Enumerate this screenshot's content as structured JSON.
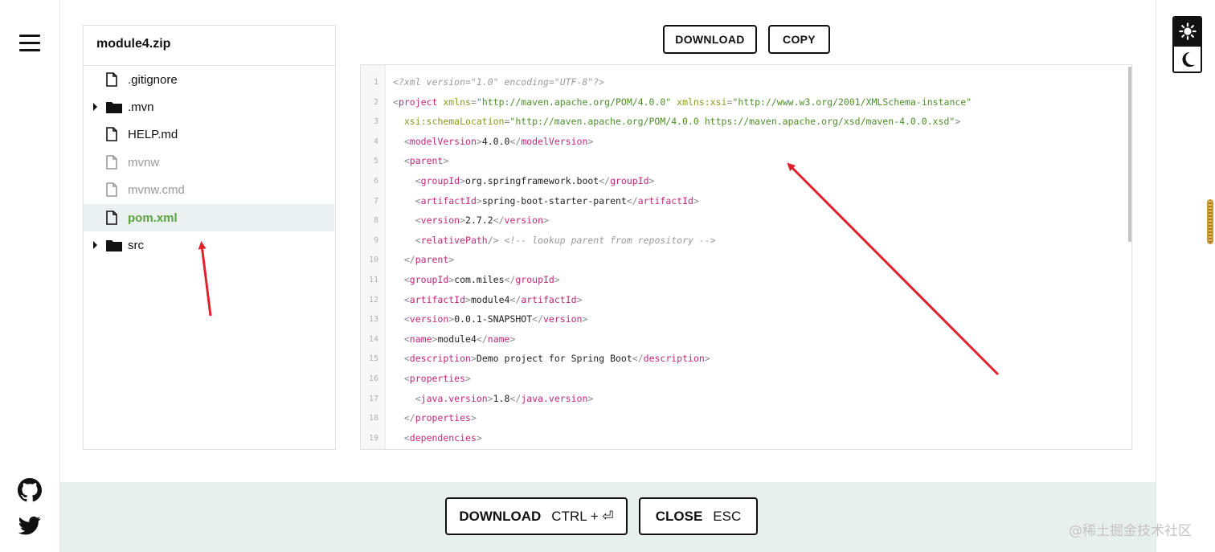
{
  "archive_name": "module4.zip",
  "tree": [
    {
      "label": ".gitignore",
      "type": "file"
    },
    {
      "label": ".mvn",
      "type": "folder"
    },
    {
      "label": "HELP.md",
      "type": "file"
    },
    {
      "label": "mvnw",
      "type": "file-dim"
    },
    {
      "label": "mvnw.cmd",
      "type": "file-dim"
    },
    {
      "label": "pom.xml",
      "type": "file-selected"
    },
    {
      "label": "src",
      "type": "folder"
    }
  ],
  "toolbar": {
    "download_label": "DOWNLOAD",
    "copy_label": "COPY"
  },
  "code": {
    "line_numbers": [
      "1",
      "2",
      "3",
      "4",
      "5",
      "6",
      "7",
      "8",
      "9",
      "10",
      "11",
      "12",
      "13",
      "14",
      "15",
      "16",
      "17",
      "18",
      "19"
    ],
    "lines": [
      "<?xml version=\"1.0\" encoding=\"UTF-8\"?>",
      "<project xmlns=\"http://maven.apache.org/POM/4.0.0\" xmlns:xsi=\"http://www.w3.org/2001/XMLSchema-instance\"",
      "  xsi:schemaLocation=\"http://maven.apache.org/POM/4.0.0 https://maven.apache.org/xsd/maven-4.0.0.xsd\">",
      "  <modelVersion>4.0.0</modelVersion>",
      "  <parent>",
      "    <groupId>org.springframework.boot</groupId>",
      "    <artifactId>spring-boot-starter-parent</artifactId>",
      "    <version>2.7.2</version>",
      "    <relativePath/> <!-- lookup parent from repository -->",
      "  </parent>",
      "  <groupId>com.miles</groupId>",
      "  <artifactId>module4</artifactId>",
      "  <version>0.0.1-SNAPSHOT</version>",
      "  <name>module4</name>",
      "  <description>Demo project for Spring Boot</description>",
      "  <properties>",
      "    <java.version>1.8</java.version>",
      "  </properties>",
      "  <dependencies>"
    ]
  },
  "footer": {
    "download_label": "DOWNLOAD",
    "download_hint": "CTRL + ⏎",
    "close_label": "CLOSE",
    "close_hint": "ESC"
  },
  "icons": [
    "menu-icon",
    "github-icon",
    "twitter-icon",
    "sun-icon",
    "moon-icon",
    "file-icon",
    "folder-icon"
  ],
  "watermark": "@稀土掘金技术社区",
  "colors": {
    "selected_text": "#5aa240",
    "selected_bg": "#eaf1f0",
    "footer_bg": "#e8f0ee",
    "tag": "#c0287a",
    "attr": "#8a9a1e",
    "string": "#4d8f2a",
    "annotation_arrow": "#e0202a"
  }
}
